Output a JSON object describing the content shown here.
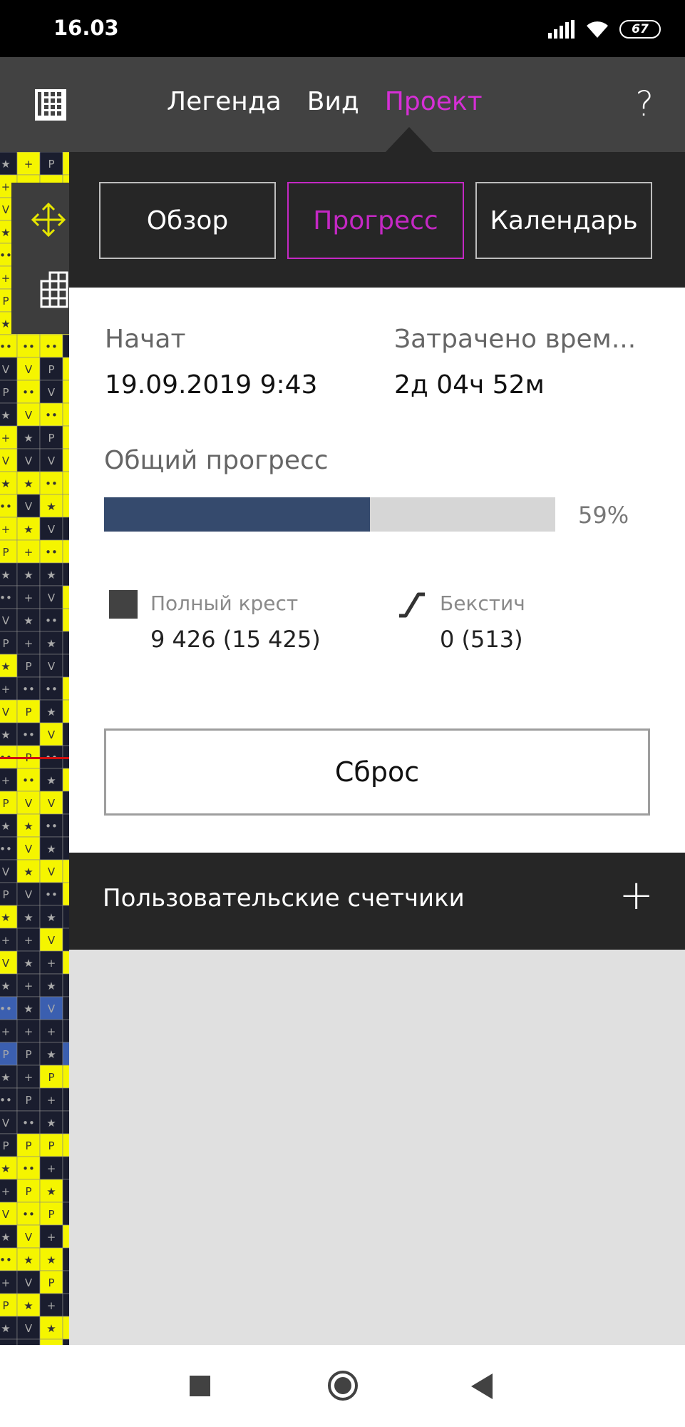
{
  "status_bar": {
    "time": "16.03",
    "battery": "67"
  },
  "top_nav": {
    "items": [
      "Легенда",
      "Вид",
      "Проект"
    ],
    "active_index": 2,
    "help": "?"
  },
  "tabs": {
    "items": [
      "Обзор",
      "Прогресс",
      "Календарь"
    ],
    "active_index": 1
  },
  "progress": {
    "started_label": "Начат",
    "started_value": "19.09.2019 9:43",
    "time_spent_label": "Затрачено врем...",
    "time_spent_value": "2д 04ч 52м",
    "overall_label": "Общий прогресс",
    "overall_percent_text": "59%",
    "overall_fraction": 0.59,
    "full_cross_label": "Полный крест",
    "full_cross_value": "9 426 (15 425)",
    "backstitch_label": "Бекстич",
    "backstitch_value": "0 (513)",
    "reset_label": "Сброс"
  },
  "custom_counters": {
    "title": "Пользовательские счетчики",
    "add": "+"
  },
  "colors": {
    "accent": "#d62fd6",
    "progress_fill": "#354a6d",
    "progress_track": "#d6d6d6",
    "dark_panel": "#262626",
    "topbar": "#424242"
  }
}
